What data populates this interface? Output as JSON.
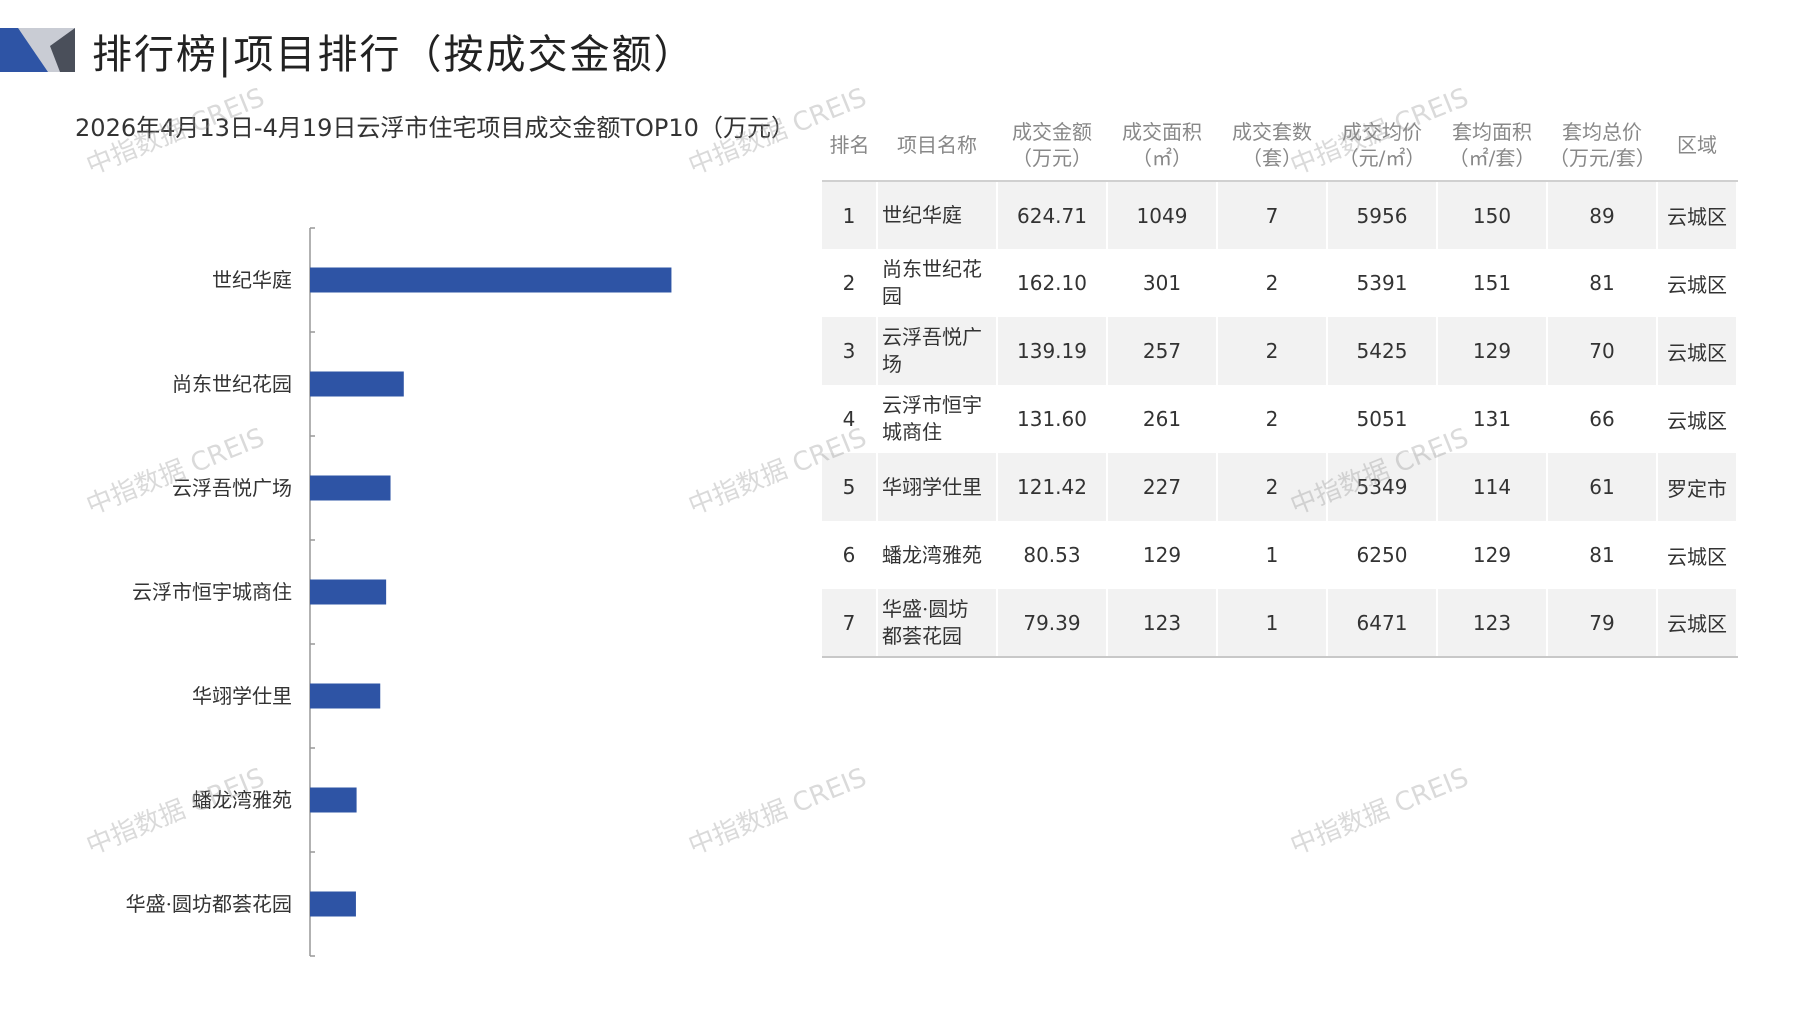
{
  "header": {
    "title": "排行榜|项目排行（按成交金额）"
  },
  "chart_data": {
    "type": "bar",
    "orientation": "horizontal",
    "title": "2026年4月13日-4月19日云浮市住宅项目成交金额TOP10（万元）",
    "categories": [
      "世纪华庭",
      "尚东世纪花园",
      "云浮吾悦广场",
      "云浮市恒宇城商住",
      "华翊学仕里",
      "蟠龙湾雅苑",
      "华盛·圆坊都荟花园"
    ],
    "values": [
      624.71,
      162.1,
      139.19,
      131.6,
      121.42,
      80.53,
      79.39
    ],
    "xlim": [
      0,
      700
    ],
    "bar_color": "#2e54a5",
    "grid": false,
    "legend": "none"
  },
  "table": {
    "headers": [
      [
        "排名"
      ],
      [
        "项目名称"
      ],
      [
        "成交金额",
        "（万元）"
      ],
      [
        "成交面积",
        "（㎡）"
      ],
      [
        "成交套数",
        "（套）"
      ],
      [
        "成交均价",
        "（元/㎡）"
      ],
      [
        "套均面积",
        "（㎡/套）"
      ],
      [
        "套均总价",
        "（万元/套）"
      ],
      [
        "区域"
      ]
    ],
    "rows": [
      {
        "rank": "1",
        "name": [
          "世纪华庭"
        ],
        "amount": "624.71",
        "area": "1049",
        "units": "7",
        "avg_price": "5956",
        "avg_area": "150",
        "avg_total": "89",
        "region": "云城区"
      },
      {
        "rank": "2",
        "name": [
          "尚东世纪花",
          "园"
        ],
        "amount": "162.10",
        "area": "301",
        "units": "2",
        "avg_price": "5391",
        "avg_area": "151",
        "avg_total": "81",
        "region": "云城区"
      },
      {
        "rank": "3",
        "name": [
          "云浮吾悦广",
          "场"
        ],
        "amount": "139.19",
        "area": "257",
        "units": "2",
        "avg_price": "5425",
        "avg_area": "129",
        "avg_total": "70",
        "region": "云城区"
      },
      {
        "rank": "4",
        "name": [
          "云浮市恒宇",
          "城商住"
        ],
        "amount": "131.60",
        "area": "261",
        "units": "2",
        "avg_price": "5051",
        "avg_area": "131",
        "avg_total": "66",
        "region": "云城区"
      },
      {
        "rank": "5",
        "name": [
          "华翊学仕里"
        ],
        "amount": "121.42",
        "area": "227",
        "units": "2",
        "avg_price": "5349",
        "avg_area": "114",
        "avg_total": "61",
        "region": "罗定市"
      },
      {
        "rank": "6",
        "name": [
          "蟠龙湾雅苑"
        ],
        "amount": "80.53",
        "area": "129",
        "units": "1",
        "avg_price": "6250",
        "avg_area": "129",
        "avg_total": "81",
        "region": "云城区"
      },
      {
        "rank": "7",
        "name": [
          "华盛·圆坊",
          "都荟花园"
        ],
        "amount": "79.39",
        "area": "123",
        "units": "1",
        "avg_price": "6471",
        "avg_area": "123",
        "avg_total": "79",
        "region": "云城区"
      }
    ]
  },
  "watermark": {
    "text": "中指数据 CREIS"
  },
  "colors": {
    "accent": "#2e54a5",
    "logo_dark": "#2e54a5",
    "logo_light": "#c9ccd4"
  }
}
